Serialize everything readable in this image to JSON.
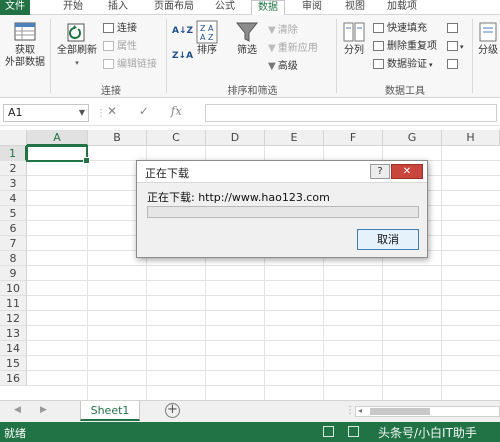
{
  "tabs": [
    "文件",
    "开始",
    "插入",
    "页面布局",
    "公式",
    "数据",
    "审阅",
    "视图",
    "加载项"
  ],
  "active_tab": "数据",
  "ribbon": {
    "get_external": "获取\n外部数据",
    "refresh_all": "全部刷新",
    "connections": "连接",
    "properties": "属性",
    "edit_links": "编辑链接",
    "group_connections": "连接",
    "sort_az": "A↓Z",
    "sort_za": "Z↓A",
    "sort": "排序",
    "filter": "筛选",
    "clear": "清除",
    "reapply": "重新应用",
    "advanced": "高级",
    "group_sort_filter": "排序和筛选",
    "text_to_columns": "分列",
    "flash_fill": "快速填充",
    "remove_duplicates": "删除重复项",
    "data_validation": "数据验证",
    "group_data_tools": "数据工具",
    "outline": "分级"
  },
  "formula_bar": {
    "name_box": "A1",
    "cancel": "✕",
    "enter": "✓",
    "fx": "fx",
    "value": ""
  },
  "columns": [
    "A",
    "B",
    "C",
    "D",
    "E",
    "F",
    "G",
    "H"
  ],
  "rows": [
    "1",
    "2",
    "3",
    "4",
    "5",
    "6",
    "7",
    "8",
    "9",
    "10",
    "11",
    "12",
    "13",
    "14",
    "15",
    "16"
  ],
  "sheet_tab": "Sheet1",
  "status": "就绪",
  "watermark": "头条号/小白IT助手",
  "dialog": {
    "title": "正在下载",
    "help": "?",
    "close": "✕",
    "message": "正在下载: http://www.hao123.com",
    "progress": 0,
    "cancel": "取消"
  },
  "colors": {
    "accent": "#217346",
    "close_button": "#c9463d"
  }
}
